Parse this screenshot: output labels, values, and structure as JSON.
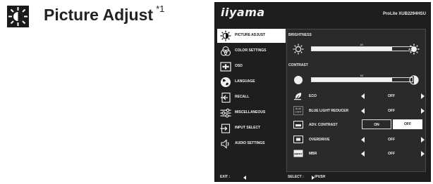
{
  "heading": {
    "icon": "sun-adjust-icon",
    "title": "Picture Adjust",
    "footnote": "*1"
  },
  "osd": {
    "logo": "iiyama",
    "model": "ProLite XUB2294HSU",
    "menu": [
      {
        "label": "PICTURE ADJUST",
        "icon": "sun-icon",
        "active": true
      },
      {
        "label": "COLOR SETTINGS",
        "icon": "color-icon",
        "active": false
      },
      {
        "label": "OSD",
        "icon": "osd-icon",
        "active": false
      },
      {
        "label": "LANGUAGE",
        "icon": "globe-icon",
        "active": false
      },
      {
        "label": "RECALL",
        "icon": "recall-icon",
        "active": false
      },
      {
        "label": "MISCELLANEOUS",
        "icon": "sliders-icon",
        "active": false
      },
      {
        "label": "INPUT SELECT",
        "icon": "input-icon",
        "active": false
      },
      {
        "label": "AUDIO SETTINGS",
        "icon": "speaker-icon",
        "active": false
      }
    ],
    "brightness": {
      "label": "BRIGHTNESS",
      "value": 80,
      "value_label": "80"
    },
    "contrast": {
      "label": "CONTRAST",
      "value": 80,
      "value_label": "80"
    },
    "options": {
      "eco": {
        "label": "ECO",
        "value": "OFF"
      },
      "blue_light": {
        "label": "BLUE LIGHT REDUCER",
        "value": "OFF",
        "icon_text_1": "BLUE",
        "icon_text_2": "LIGHT"
      },
      "adv_contrast": {
        "label": "ADV. CONTRAST",
        "on_label": "ON",
        "off_label": "OFF",
        "selected": "OFF"
      },
      "overdrive": {
        "label": "OVERDRIVE",
        "value": "OFF"
      },
      "mbr": {
        "label": "MBR",
        "value": "OFF",
        "icon_text": "MPRT"
      }
    },
    "footer": {
      "exit_label": "EXIT :",
      "select_label": "SELECT :",
      "push_label": "/PUSH"
    }
  }
}
